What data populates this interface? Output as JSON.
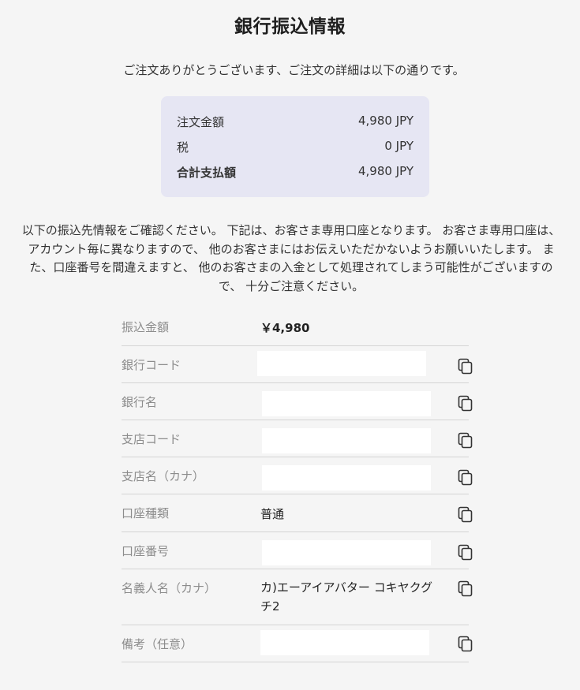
{
  "title": "銀行振込情報",
  "intro": "ご注文ありがとうございます、ご注文の詳細は以下の通りです。",
  "summary": {
    "rows": [
      {
        "label": "注文金額",
        "value": "4,980 JPY"
      },
      {
        "label": "税",
        "value": "0 JPY"
      },
      {
        "label": "合計支払額",
        "value": "4,980 JPY"
      }
    ]
  },
  "notice": {
    "lines": [
      "以下の振込先情報をご確認ください。 下記は、お客さま専用口座となります。 お客さま専用口座は、",
      "アカウント毎に異なりますので、 他のお客さまにはお伝えいただかないようお願いいたします。 ま",
      "た、口座番号を間違えますと、 他のお客さまの入金として処理されてしまう可能性がございますの",
      "で、 十分ご注意ください。"
    ]
  },
  "transfer": {
    "rows": [
      {
        "label": "振込金額",
        "value": "￥4,980",
        "bold": true,
        "masked": false,
        "copy": false
      },
      {
        "label": "銀行コード",
        "value": "",
        "masked": true,
        "copy": true
      },
      {
        "label": "銀行名",
        "value": "",
        "masked": true,
        "copy": true
      },
      {
        "label": "支店コード",
        "value": "",
        "masked": true,
        "copy": true
      },
      {
        "label": "支店名（カナ）",
        "value": "",
        "masked": true,
        "copy": true
      },
      {
        "label": "口座種類",
        "value": "普通",
        "masked": false,
        "copy": true
      },
      {
        "label": "口座番号",
        "value": "",
        "masked": true,
        "copy": true
      },
      {
        "label": "名義人名（カナ）",
        "value": "カ)エーアイアバター コキヤクグ",
        "value2": "チ2",
        "masked": false,
        "copy": true
      },
      {
        "label": "備考（任意）",
        "value": "",
        "masked": true,
        "copy": true
      }
    ]
  },
  "icons": {
    "copy": "copy-icon"
  },
  "colors": {
    "summary_bg": "#e6e6f3",
    "label": "#8c8c8c",
    "divider": "#d4d4d4"
  }
}
